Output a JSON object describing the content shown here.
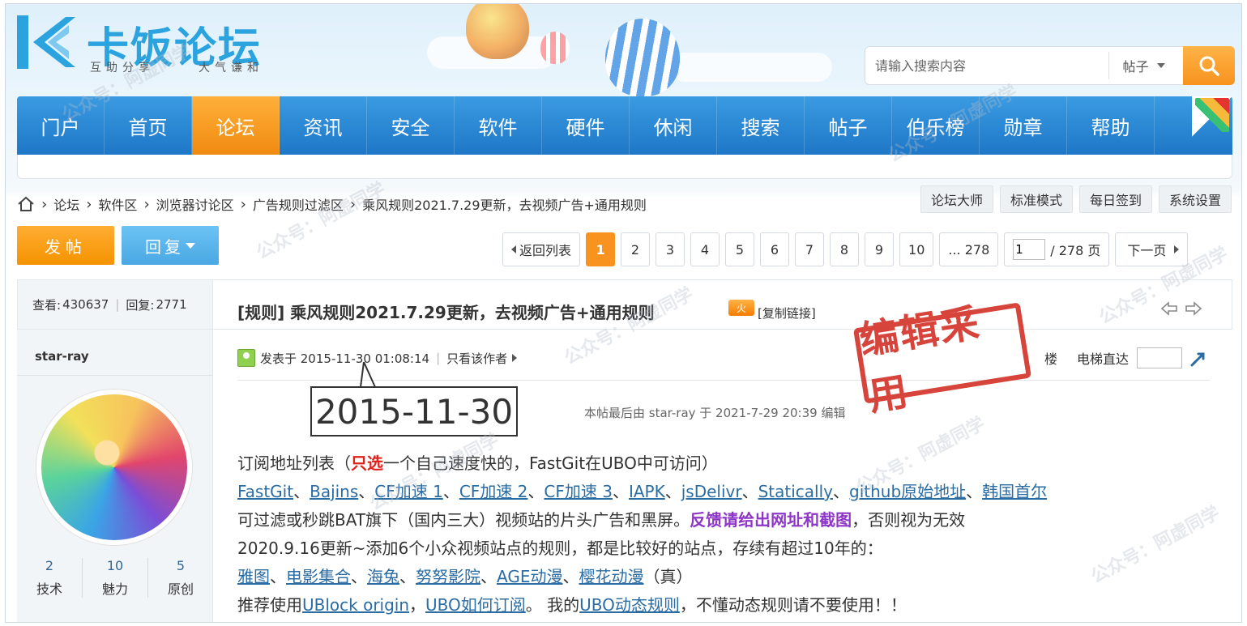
{
  "logo": {
    "title": "卡饭论坛",
    "slogan_left": "互助分享",
    "slogan_right": "大气谦和"
  },
  "search": {
    "placeholder": "请输入搜索内容",
    "type_label": "帖子"
  },
  "nav": {
    "items": [
      "门户",
      "首页",
      "论坛",
      "资讯",
      "安全",
      "软件",
      "硬件",
      "休闲",
      "搜索",
      "帖子",
      "伯乐榜",
      "勋章",
      "帮助"
    ],
    "active_index": 2
  },
  "breadcrumb": {
    "items": [
      "论坛",
      "软件区",
      "浏览器讨论区",
      "广告规则过滤区",
      "乘风规则2021.7.29更新，去视频广告+通用规则"
    ]
  },
  "user_tools": [
    "论坛大师",
    "标准模式",
    "每日签到",
    "系统设置"
  ],
  "actions": {
    "post_label": "发帖",
    "reply_label": "回复"
  },
  "pager": {
    "back_label": "返回列表",
    "pages": [
      "1",
      "2",
      "3",
      "4",
      "5",
      "6",
      "7",
      "8",
      "9",
      "10",
      "... 278"
    ],
    "current": "1",
    "jump_value": "1",
    "total_label": "/ 278 页",
    "next_label": "下一页"
  },
  "thread": {
    "views_label": "查看:",
    "views": "430637",
    "replies_label": "回复:",
    "replies": "2771",
    "title": "[规则] 乘风规则2021.7.29更新，去视频广告+通用规则",
    "hot_badge": "火",
    "copy_link": "[复制链接]"
  },
  "author": {
    "name": "star-ray",
    "stats": [
      {
        "value": "2",
        "label": "技术"
      },
      {
        "value": "10",
        "label": "魅力"
      },
      {
        "value": "5",
        "label": "原创"
      }
    ]
  },
  "post": {
    "posted_at": "发表于 2015-11-30 01:08:14",
    "only_author": "只看该作者",
    "floor_label": "楼",
    "elevator_label": "电梯直达",
    "callout_date": "2015-11-30",
    "edited_note": "本帖最后由 star-ray 于 2021-7-29 20:39 编辑",
    "stamp": "编辑采用",
    "line1_a": "订阅地址列表（",
    "line1_red": "只选",
    "line1_b": "一个自己速度快的，FastGit在UBO中可访问）",
    "links": [
      "FastGit",
      "Bajins",
      "CF加速 1",
      "CF加速 2",
      "CF加速 3",
      "IAPK",
      "jsDelivr",
      "Statically",
      "github原始地址",
      "韩国首尔"
    ],
    "line3_a": "可过滤或秒跳BAT旗下（国内三大）视频站的片头广告和黑屏。",
    "line3_purple": "反馈请给出网址和截图",
    "line3_b": "，否则视为无效",
    "line4": "2020.9.16更新~添加6个小众视频站点的规则，都是比较好的站点，存续有超过10年的：",
    "sites": [
      "雅图",
      "电影集合",
      "海兔",
      "努努影院",
      "AGE动漫",
      "樱花动漫"
    ],
    "sites_suffix": "（真）",
    "line6_a": "推荐使用",
    "line6_link1": "UBlock origin",
    "line6_sep": "，",
    "line6_link2": "UBO如何订阅",
    "line6_b": "。 我的",
    "line6_link3": "UBO动态规则",
    "line6_c": "，不懂动态规则请不要使用！！"
  },
  "watermark": "公众号：阿虚同学",
  "colors": {
    "nav_blue": "#1e77c7",
    "accent_orange": "#f7931e",
    "link_blue": "#2b6ca3",
    "stamp_red": "#d4352b"
  }
}
